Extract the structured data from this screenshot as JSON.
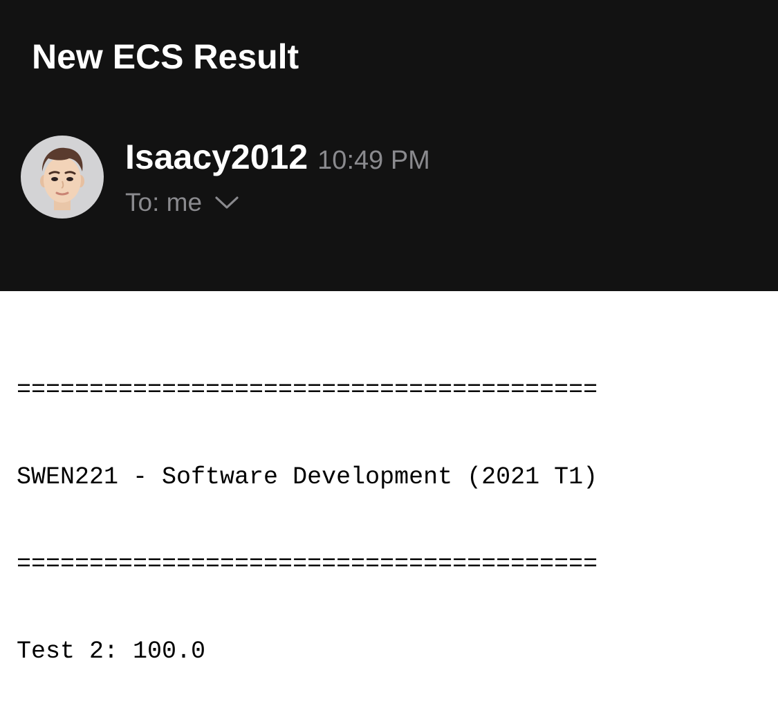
{
  "email": {
    "subject": "New ECS Result",
    "sender": "Isaacy2012",
    "time": "10:49 PM",
    "recipient_label": "To: me",
    "avatar_icon": "memoji-avatar-icon",
    "expand_icon": "chevron-down-icon"
  },
  "body": {
    "lines": [
      "========================================",
      "SWEN221 - Software Development (2021 T1)",
      "========================================",
      "Test 2: 100.0"
    ]
  },
  "colors": {
    "header_background": "#121212",
    "secondary_text": "#8a8a8e",
    "body_background": "#ffffff"
  }
}
